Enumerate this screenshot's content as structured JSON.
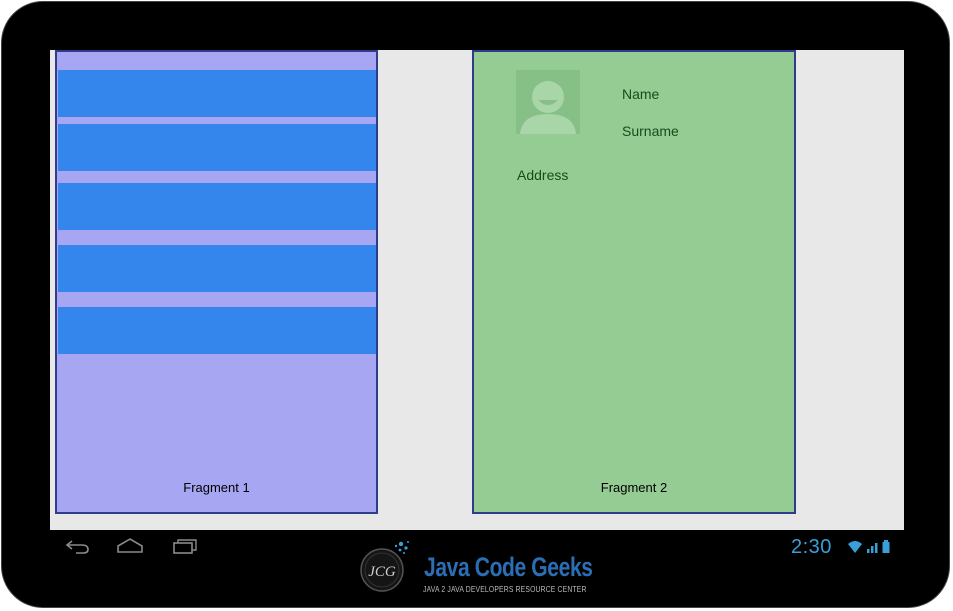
{
  "fragment1": {
    "label": "Fragment 1",
    "list_items": [
      {},
      {},
      {},
      {},
      {}
    ]
  },
  "fragment2": {
    "label": "Fragment 2",
    "name_label": "Name",
    "surname_label": "Surname",
    "address_label": "Address"
  },
  "navbar": {
    "buttons": [
      "back-icon",
      "home-icon",
      "recent-apps-icon"
    ]
  },
  "status": {
    "time": "2:30",
    "icons": [
      "wifi-icon",
      "signal-icon",
      "battery-icon"
    ]
  },
  "watermark": {
    "brand": "Java Code Geeks",
    "tagline": "JAVA 2 JAVA DEVELOPERS RESOURCE CENTER",
    "monogram": "JCG"
  },
  "colors": {
    "fragment1_bg": "#a6a6f2",
    "list_item": "#3586ec",
    "fragment2_bg": "#95cc94",
    "border": "#2d3d8c",
    "clock": "#3a9fd8"
  }
}
